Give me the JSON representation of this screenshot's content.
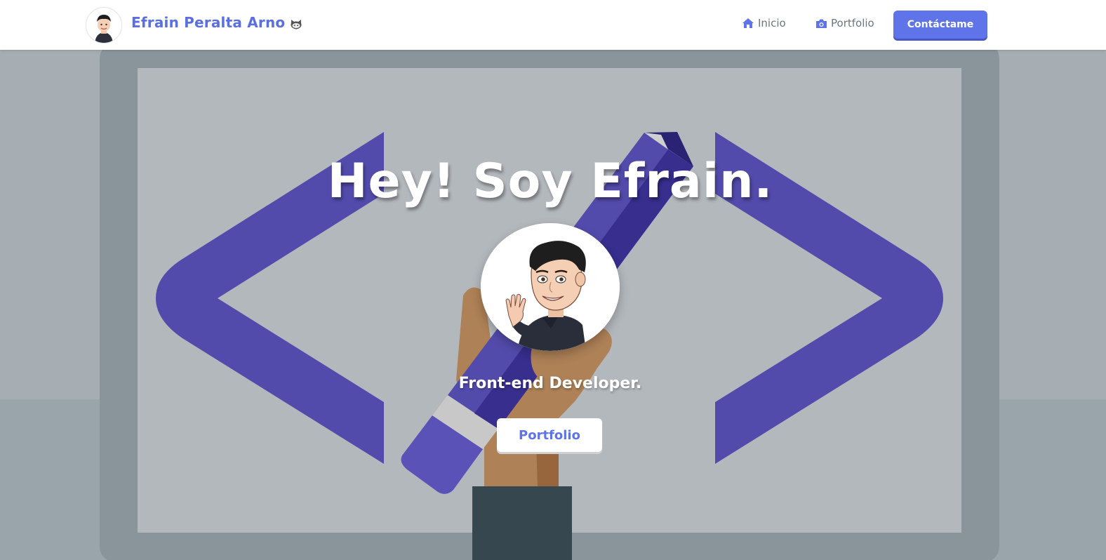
{
  "navbar": {
    "brand_name": "Efrain Peralta Arno",
    "links": [
      {
        "label": "Inicio",
        "icon": "home-icon"
      },
      {
        "label": "Portfolio",
        "icon": "camera-icon"
      }
    ],
    "contact_label": "Contáctame",
    "accent_color": "#5f74e8"
  },
  "hero": {
    "title": "Hey! Soy Efrain.",
    "subtitle": "Front-end Developer.",
    "button_label": "Portfolio",
    "background_icon": "code-brackets-pencil-illustration",
    "bracket_color": "#534bab"
  }
}
